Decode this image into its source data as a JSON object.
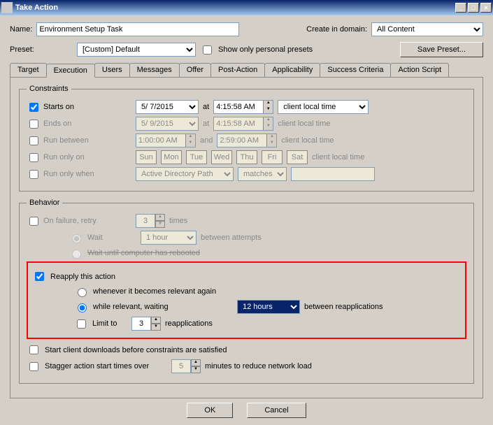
{
  "window": {
    "title": "Take Action"
  },
  "header": {
    "name_label": "Name:",
    "name_value": "Environment Setup Task",
    "domain_label": "Create in domain:",
    "domain_value": "All Content",
    "preset_label": "Preset:",
    "preset_value": "[Custom] Default",
    "personal_only": "Show only personal presets",
    "save_preset": "Save Preset..."
  },
  "tabs": [
    "Target",
    "Execution",
    "Users",
    "Messages",
    "Offer",
    "Post-Action",
    "Applicability",
    "Success Criteria",
    "Action Script"
  ],
  "constraints": {
    "legend": "Constraints",
    "starts_on": "Starts on",
    "starts_date": "5/ 7/2015",
    "at": "at",
    "starts_time": "4:15:58 AM",
    "tz": "client local time",
    "ends_on": "Ends on",
    "ends_date": "5/ 9/2015",
    "ends_time": "4:15:58 AM",
    "run_between": "Run between",
    "rb_from": "1:00:00 AM",
    "and": "and",
    "rb_to": "2:59:00 AM",
    "run_only_on": "Run only on",
    "days": [
      "Sun",
      "Mon",
      "Tue",
      "Wed",
      "Thu",
      "Fri",
      "Sat"
    ],
    "run_only_when": "Run only when",
    "row_path": "Active Directory Path",
    "row_op": "matches"
  },
  "behavior": {
    "legend": "Behavior",
    "on_failure": "On failure, retry",
    "retry_n": "3",
    "times": "times",
    "wait": "Wait",
    "wait_val": "1 hour",
    "between_attempts": "between attempts",
    "wait_reboot": "Wait until computer has rebooted",
    "reapply": "Reapply this action",
    "whenever": "whenever it becomes relevant again",
    "while": "while relevant, waiting",
    "interval": "12 hours",
    "between_reapp": "between reapplications",
    "limit_to": "Limit to",
    "limit_n": "3",
    "reapplications": "reapplications",
    "start_downloads": "Start client downloads before constraints are satisfied",
    "stagger": "Stagger action start times over",
    "stagger_n": "5",
    "stagger_tail": "minutes to reduce network load"
  },
  "buttons": {
    "ok": "OK",
    "cancel": "Cancel"
  }
}
